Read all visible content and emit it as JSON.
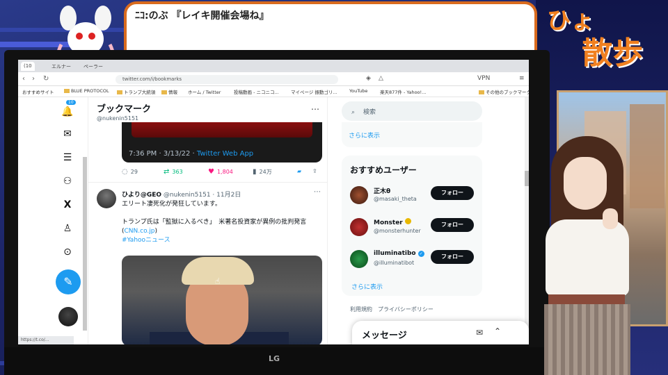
{
  "overlay": {
    "dialog_text": "ﾆｺ:のぶ 『レイキ開催会場ね』",
    "title_line1": "ひょ",
    "title_line2": "散歩",
    "monitor_brand": "LG"
  },
  "browser": {
    "tabs": [
      {
        "label": "(10"
      },
      {
        "label": "エルナー"
      },
      {
        "label": "ペーラー"
      }
    ],
    "url": "twitter.com/i/bookmarks",
    "extensions": [
      "VPN"
    ],
    "bookmarks": [
      {
        "label": "おすすめサイト"
      },
      {
        "label": "BLUE PROTOCOL"
      },
      {
        "label": "トランプ大統領"
      },
      {
        "label": "情報"
      },
      {
        "label": "ホーム / Twitter"
      },
      {
        "label": "投稿動画 - ニコニコ..."
      },
      {
        "label": "マイページ 振動ゴリ..."
      },
      {
        "label": "YouTube"
      },
      {
        "label": "楽天877件 - Yahoo!..."
      },
      {
        "label": "その他のブックマーク"
      }
    ],
    "status_url": "https://t.co/..."
  },
  "sidebar": {
    "notification_count": "10",
    "icons": [
      "bell-icon",
      "mail-icon",
      "list-icon",
      "people-icon",
      "x-logo-icon",
      "profile-icon",
      "more-circle-icon"
    ]
  },
  "main": {
    "title": "ブックマーク",
    "handle": "@nukenin5151",
    "embed_time": "7:36 PM · 3/13/22 · ",
    "embed_source": "Twitter Web App",
    "stats": {
      "replies": "29",
      "retweets": "363",
      "likes": "1,804",
      "views": "24万"
    },
    "tweet": {
      "name": "ひより@GEO",
      "handle_date": "@nukenin5151 · 11月2日",
      "line1": "エリート凄死化が発狂しています。",
      "line2": "トランプ氏は「監獄に入るべき」　米著名投資家が異例の批判発言(",
      "link": "CNN.co.jp",
      "line2_end": ")",
      "hashtag": "#Yahooニュース"
    }
  },
  "right": {
    "search_placeholder": "検索",
    "show_more": "さらに表示",
    "recommend_title": "おすすめユーザー",
    "users": [
      {
        "name": "正木θ",
        "handle": "@masaki_theta",
        "follow": "フォロー"
      },
      {
        "name": "Monster",
        "handle": "@monsterhunter",
        "follow": "フォロー"
      },
      {
        "name": "illuminatibo",
        "handle": "@illuminatibot",
        "follow": "フォロー"
      }
    ],
    "show_more2": "さらに表示",
    "footer": "利用規約　プライバシーポリシー"
  },
  "messages": {
    "title": "メッセージ"
  },
  "colors": {
    "accent": "#1d9bf0",
    "like": "#f91880",
    "retweet": "#00ba7c",
    "overlay_orange": "#f08020"
  }
}
